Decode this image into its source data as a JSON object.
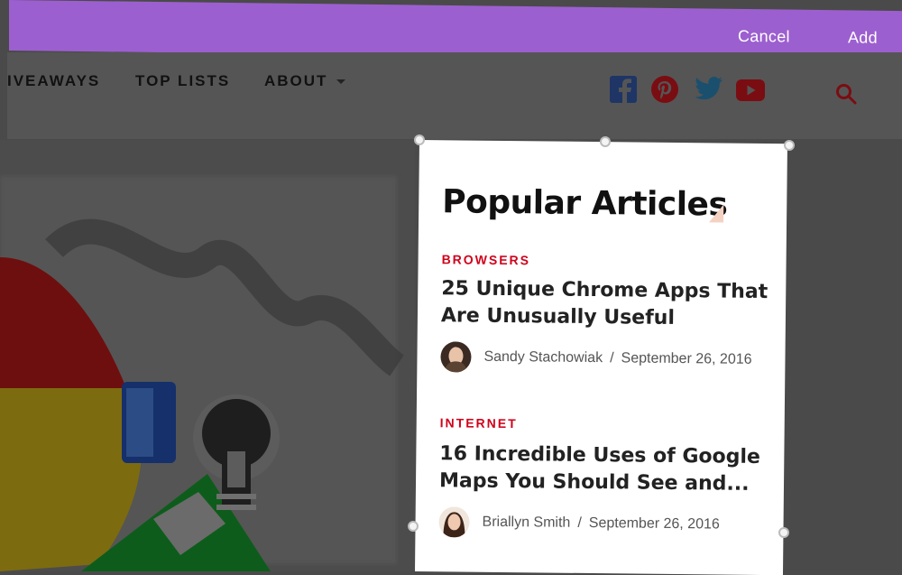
{
  "topbar": {
    "cancel_label": "Cancel",
    "add_label": "Add"
  },
  "nav": {
    "items": [
      {
        "label": "IVEAWAYS"
      },
      {
        "label": "TOP LISTS"
      },
      {
        "label": "ABOUT"
      }
    ],
    "social_icons": [
      "facebook-icon",
      "pinterest-icon",
      "twitter-icon",
      "youtube-icon"
    ],
    "search_icon": "search-icon"
  },
  "card": {
    "title": "Popular Articles",
    "articles": [
      {
        "category": "BROWSERS",
        "title": "25 Unique Chrome Apps That Are Unusually Useful",
        "author": "Sandy Stachowiak",
        "date": "September 26, 2016"
      },
      {
        "category": "INTERNET",
        "title": "16 Incredible Uses of Google Maps You Should See and...",
        "author": "Briallyn Smith",
        "date": "September 26, 2016"
      }
    ]
  },
  "colors": {
    "topbar": "#9c5fcf",
    "accent_red": "#d0021b",
    "overlay": "#4a4a4a"
  }
}
